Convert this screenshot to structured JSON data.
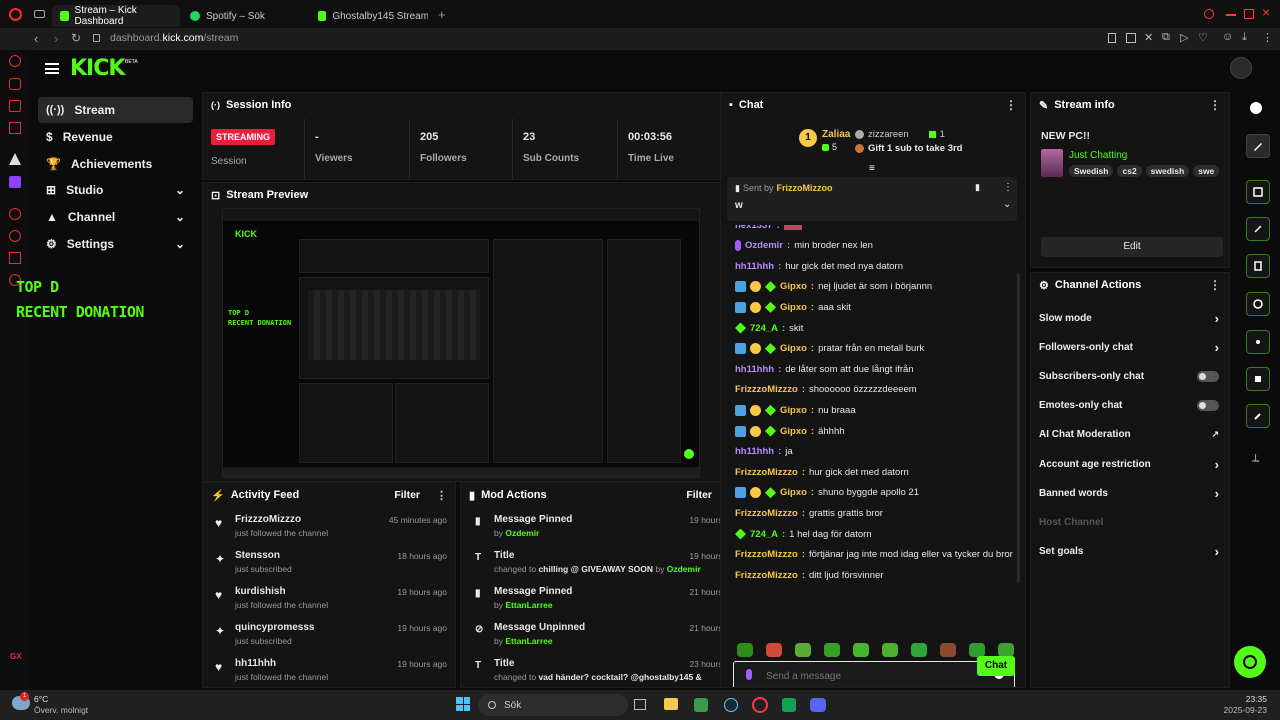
{
  "browser": {
    "tabs": [
      {
        "label": "Stream – Kick Dashboard",
        "active": true
      },
      {
        "label": "Spotify – Sök",
        "active": false
      },
      {
        "label": "Ghostalby145 Stream - W",
        "active": false
      }
    ],
    "url_prefix": "dashboard.",
    "url_domain": "kick.com",
    "url_path": "/stream"
  },
  "brand": {
    "logo": "KICK",
    "beta": "BETA",
    "accent": "#53fc18"
  },
  "sidebar": {
    "items": [
      {
        "label": "Stream",
        "icon": "broadcast-icon"
      },
      {
        "label": "Revenue",
        "icon": "dollar-icon"
      },
      {
        "label": "Achievements",
        "icon": "trophy-icon"
      },
      {
        "label": "Studio",
        "icon": "sliders-icon"
      },
      {
        "label": "Channel",
        "icon": "user-icon"
      },
      {
        "label": "Settings",
        "icon": "gear-icon"
      }
    ],
    "overlay_line1": "TOP D",
    "overlay_line2": "RECENT DONATION"
  },
  "session": {
    "title": "Session Info",
    "status": "STREAMING",
    "status_label": "Session",
    "stats": [
      {
        "value": "-",
        "label": "Viewers"
      },
      {
        "value": "205",
        "label": "Followers"
      },
      {
        "value": "23",
        "label": "Sub Counts"
      },
      {
        "value": "00:03:56",
        "label": "Time Live"
      }
    ]
  },
  "preview": {
    "title": "Stream Preview"
  },
  "activity": {
    "title": "Activity Feed",
    "filter": "Filter",
    "items": [
      {
        "name": "FrizzzoMizzzo",
        "sub": "just followed the channel",
        "time": "45 minutes ago",
        "icon": "heart-icon"
      },
      {
        "name": "Stensson",
        "sub": "just subscribed",
        "time": "18 hours ago",
        "icon": "sparkle-icon"
      },
      {
        "name": "kurdishish",
        "sub": "just followed the channel",
        "time": "19 hours ago",
        "icon": "heart-icon"
      },
      {
        "name": "quincypromesss",
        "sub": "just subscribed",
        "time": "19 hours ago",
        "icon": "sparkle-icon"
      },
      {
        "name": "hh11hhh",
        "sub": "just followed the channel",
        "time": "19 hours ago",
        "icon": "heart-icon"
      }
    ]
  },
  "mod": {
    "title": "Mod Actions",
    "filter": "Filter",
    "items": [
      {
        "title": "Message Pinned",
        "pre": "by",
        "detail": "",
        "by": "Ozdemir",
        "time": "19 hours ago",
        "icon": "pin-icon"
      },
      {
        "title": "Title",
        "pre": "changed to",
        "detail": "chilling @ GIVEAWAY SOON",
        "by": "Ozdemir",
        "time": "19 hours ago",
        "icon": "title-icon"
      },
      {
        "title": "Message Pinned",
        "pre": "by",
        "detail": "",
        "by": "EttanLarree",
        "time": "21 hours ago",
        "icon": "pin-icon"
      },
      {
        "title": "Message Unpinned",
        "pre": "by",
        "detail": "",
        "by": "EttanLarree",
        "time": "21 hours ago",
        "icon": "unpin-icon"
      },
      {
        "title": "Title",
        "pre": "changed to",
        "detail": "vad händer? cocktail? @ghostalby145 &",
        "by": "",
        "time": "23 hours ago",
        "icon": "title-icon"
      }
    ]
  },
  "chat": {
    "title": "Chat",
    "leader_name": "Zaliaa",
    "leader_count": "5",
    "second_name": "zizzareen",
    "second_count": "1",
    "gift_text": "Gift 1 sub to take 3rd",
    "pinned_prefix": "Sent by",
    "pinned_by": "FrizzoMizzoo",
    "pinned_text": "w",
    "messages": [
      {
        "user": "hex1337",
        "text": "",
        "color": "#b98bff",
        "badges": 0
      },
      {
        "user": "Ozdemir",
        "text": "min broder nex len",
        "color": "#b98bff",
        "badges": 1
      },
      {
        "user": "hh11hhh",
        "text": "hur gick det med nya datorn",
        "color": "#b98bff",
        "badges": 0
      },
      {
        "user": "Gipxo",
        "text": "nej ljudet är som i börjannn",
        "color": "#f7c948",
        "badges": 3
      },
      {
        "user": "Gipxo",
        "text": "aaa skit",
        "color": "#f7c948",
        "badges": 3
      },
      {
        "user": "724_A",
        "text": "skit",
        "color": "#53fc18",
        "badges": 1
      },
      {
        "user": "Gipxo",
        "text": "pratar från en metall burk",
        "color": "#f7c948",
        "badges": 3
      },
      {
        "user": "hh11hhh",
        "text": "de låter som att due långt ifrån",
        "color": "#b98bff",
        "badges": 0
      },
      {
        "user": "FrizzzoMizzzo",
        "text": "shoooooo özzzzzdeeeem",
        "color": "#f7c948",
        "badges": 0
      },
      {
        "user": "Gipxo",
        "text": "nu braaa",
        "color": "#f7c948",
        "badges": 3
      },
      {
        "user": "Gipxo",
        "text": "ähhhh",
        "color": "#f7c948",
        "badges": 3
      },
      {
        "user": "hh11hhh",
        "text": "ja",
        "color": "#b98bff",
        "badges": 0
      },
      {
        "user": "FrizzzoMizzzo",
        "text": "hur gick det med datorn",
        "color": "#f7c948",
        "badges": 0
      },
      {
        "user": "Gipxo",
        "text": "shuno byggde apollo 21",
        "color": "#f7c948",
        "badges": 3
      },
      {
        "user": "FrizzzoMizzzo",
        "text": "grattis grattis bror",
        "color": "#f7c948",
        "badges": 0
      },
      {
        "user": "724_A",
        "text": "1 hel dag för datorn",
        "color": "#53fc18",
        "badges": 1
      },
      {
        "user": "FrizzzoMizzzo",
        "text": "förtjänar jag inte mod idag eller va tycker du bror",
        "color": "#f7c948",
        "badges": 0
      },
      {
        "user": "FrizzzoMizzzo",
        "text": "ditt ljud försvinner",
        "color": "#f7c948",
        "badges": 0
      }
    ],
    "input_placeholder": "Send a message",
    "send_label": "Chat"
  },
  "stream_info": {
    "title": "Stream info",
    "stream_title": "NEW PC!!",
    "category": "Just Chatting",
    "tags": [
      "Swedish",
      "cs2",
      "swedish",
      "swe"
    ],
    "edit_label": "Edit"
  },
  "channel_actions": {
    "title": "Channel Actions",
    "items": [
      {
        "label": "Slow mode",
        "control": "chevron"
      },
      {
        "label": "Followers-only chat",
        "control": "chevron"
      },
      {
        "label": "Subscribers-only chat",
        "control": "toggle"
      },
      {
        "label": "Emotes-only chat",
        "control": "toggle"
      },
      {
        "label": "AI Chat Moderation",
        "control": "external"
      },
      {
        "label": "Account age restriction",
        "control": "chevron"
      },
      {
        "label": "Banned words",
        "control": "chevron"
      },
      {
        "label": "Host Channel",
        "control": "none"
      },
      {
        "label": "Set goals",
        "control": "chevron"
      }
    ]
  },
  "taskbar": {
    "temp": "6°C",
    "weather": "Överv. molnigt",
    "search": "Sök",
    "time": "23:35",
    "date": "2025-09-23"
  }
}
